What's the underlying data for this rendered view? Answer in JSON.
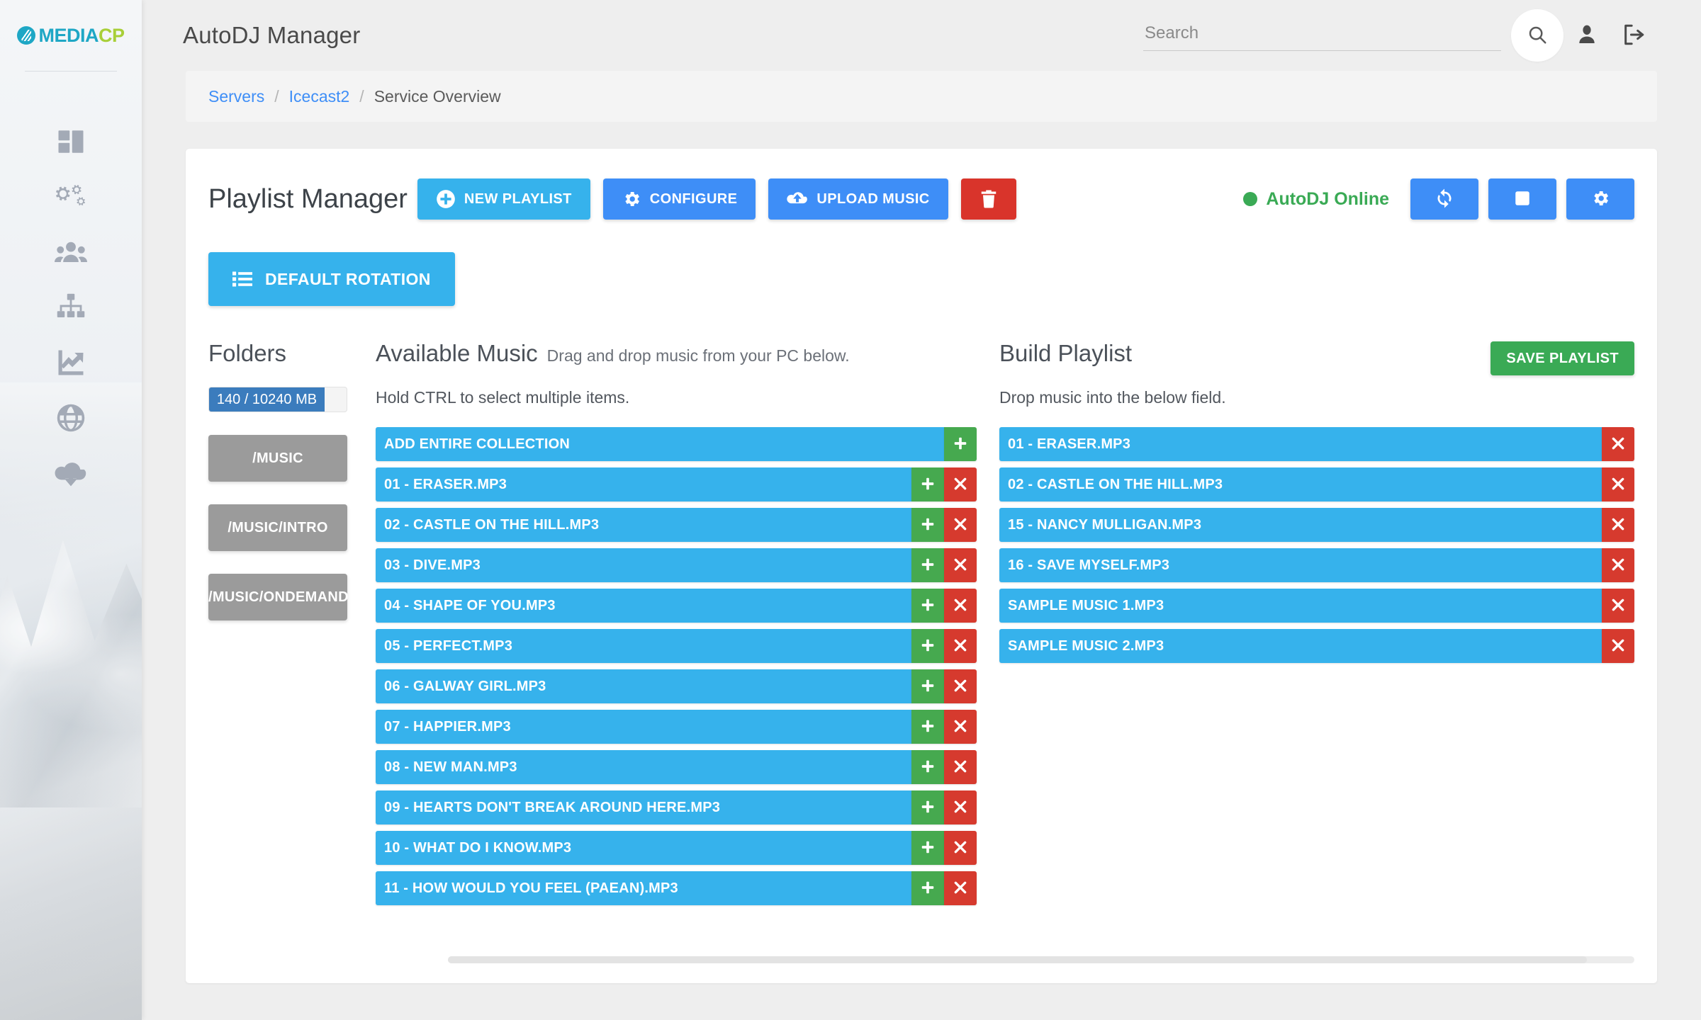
{
  "brand": {
    "media": "MEDIA",
    "cp": "CP"
  },
  "sidebar": {
    "items": [
      {
        "name": "dashboard",
        "icon": "dashboard-icon"
      },
      {
        "name": "settings",
        "icon": "gears-icon"
      },
      {
        "name": "users",
        "icon": "users-icon"
      },
      {
        "name": "servers",
        "icon": "sitemap-icon"
      },
      {
        "name": "statistics",
        "icon": "chart-line-icon"
      },
      {
        "name": "web",
        "icon": "globe-icon"
      },
      {
        "name": "downloads",
        "icon": "cloud-download-icon"
      }
    ]
  },
  "header": {
    "title": "AutoDJ Manager",
    "search_placeholder": "Search",
    "search_value": "",
    "search_icon": "search-icon",
    "account_icon": "user-icon",
    "logout_icon": "logout-icon"
  },
  "breadcrumb": {
    "items": [
      "Servers",
      "Icecast2",
      "Service Overview"
    ],
    "separator": "/"
  },
  "playlist_manager": {
    "title": "Playlist Manager",
    "buttons": [
      {
        "label": "NEW PLAYLIST",
        "icon": "plus-circle-icon",
        "color": "#36b2ec"
      },
      {
        "label": "CONFIGURE",
        "icon": "gear-icon",
        "color": "#3e8ef7"
      },
      {
        "label": "UPLOAD MUSIC",
        "icon": "cloud-upload-icon",
        "color": "#3e8ef7"
      },
      {
        "label": "",
        "icon": "trash-icon",
        "color": "#d9342b"
      }
    ],
    "status": {
      "text": "AutoDJ Online",
      "color": "#3aaa55"
    },
    "control_buttons": [
      {
        "icon": "refresh-icon",
        "color": "#3e8ef7"
      },
      {
        "icon": "stop-square-icon",
        "color": "#3e8ef7"
      },
      {
        "icon": "gear-icon",
        "color": "#3e8ef7"
      }
    ],
    "rotation_button": {
      "label": "DEFAULT ROTATION",
      "icon": "list-icon",
      "color": "#36b2ec"
    }
  },
  "folders": {
    "title": "Folders",
    "quota": {
      "label": "140 / 10240 MB",
      "used_mb": 140,
      "total_mb": 10240,
      "fill_percent": 84
    },
    "items": [
      "/MUSIC",
      "/MUSIC/INTRO",
      "/MUSIC/ONDEMAND"
    ]
  },
  "available_music": {
    "title": "Available Music",
    "subtitle": "Drag and drop music from your PC below.",
    "hint": "Hold CTRL to select multiple items.",
    "add_all_label": "ADD ENTIRE COLLECTION",
    "items": [
      "01 - ERASER.MP3",
      "02 - CASTLE ON THE HILL.MP3",
      "03 - DIVE.MP3",
      "04 - SHAPE OF YOU.MP3",
      "05 - PERFECT.MP3",
      "06 - GALWAY GIRL.MP3",
      "07 - HAPPIER.MP3",
      "08 - NEW MAN.MP3",
      "09 - HEARTS DON'T BREAK AROUND HERE.MP3",
      "10 - WHAT DO I KNOW.MP3",
      "11 - HOW WOULD YOU FEEL (PAEAN).MP3"
    ]
  },
  "build_playlist": {
    "title": "Build Playlist",
    "hint": "Drop music into the below field.",
    "save_label": "SAVE PLAYLIST",
    "items": [
      "01 - ERASER.MP3",
      "02 - CASTLE ON THE HILL.MP3",
      "15 - NANCY MULLIGAN.MP3",
      "16 - SAVE MYSELF.MP3",
      "SAMPLE MUSIC 1.MP3",
      "SAMPLE MUSIC 2.MP3"
    ]
  }
}
